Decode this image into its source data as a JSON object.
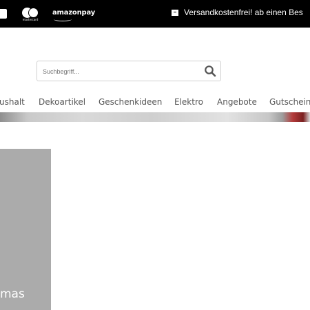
{
  "payment": {
    "icons": [
      "card-icon",
      "mastercard-icon",
      "amazon-pay-icon"
    ],
    "mastercard_label": "mastercard",
    "amazon_pay_label": "amazonpay"
  },
  "topbar": {
    "shipping_text": "Versandkostenfrei! ab einen Bes",
    "shipping_icon": "box-icon"
  },
  "search": {
    "placeholder": "Suchbegriff...",
    "icon": "search-icon"
  },
  "nav": {
    "items": [
      "ushalt",
      "Dekoartikel",
      "Geschenkideen",
      "Elektro",
      "Angebote",
      "Gutscheine"
    ]
  },
  "tile": {
    "caption": "mas"
  },
  "colors": {
    "topbar": "#000000",
    "tile": "#ababab",
    "nav_text": "#555555",
    "search_border": "#d0d0d0"
  }
}
